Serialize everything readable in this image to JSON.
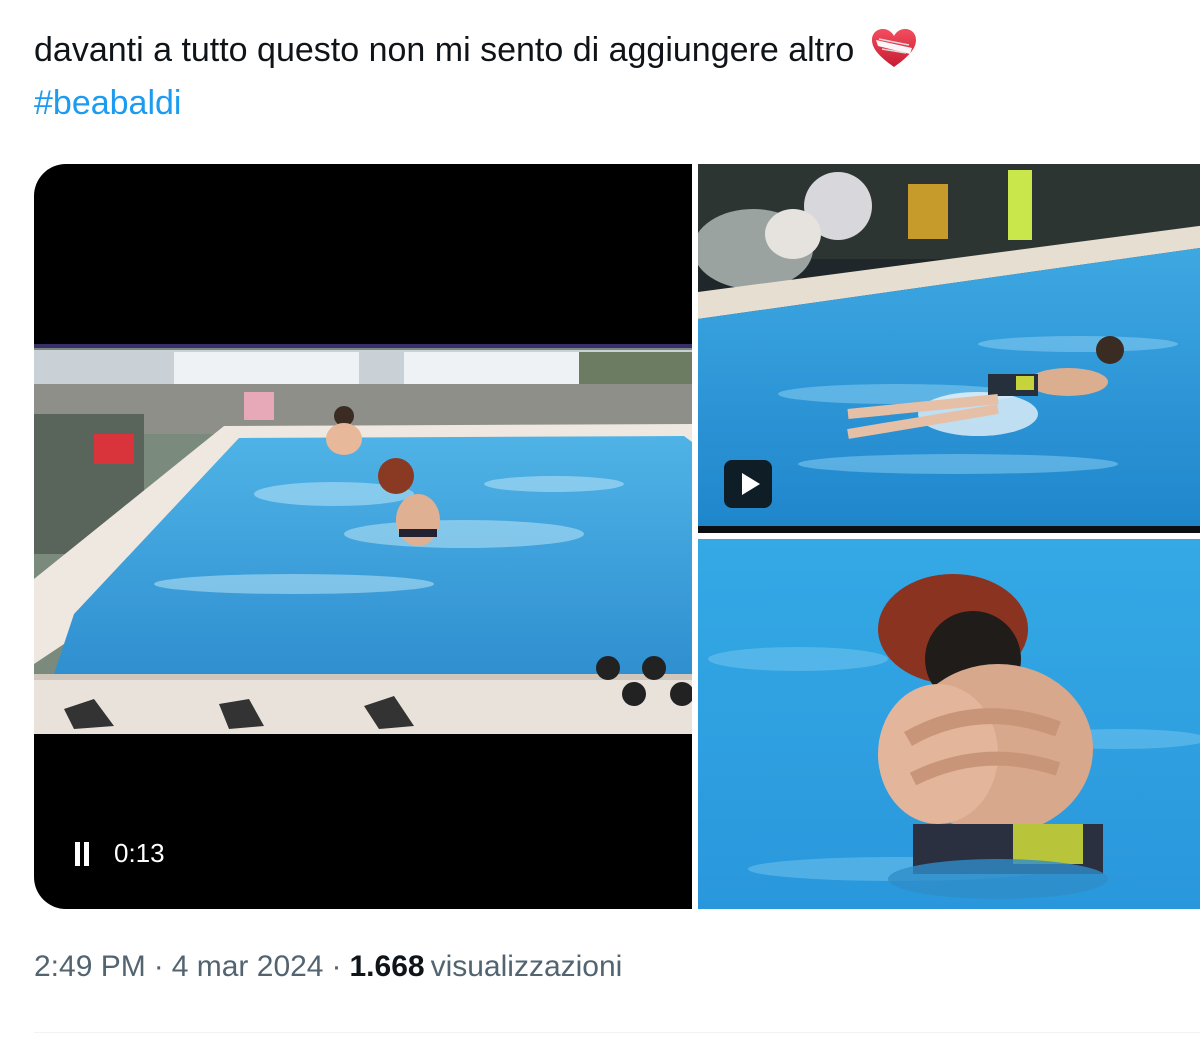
{
  "tweet": {
    "text": "davanti a tutto questo non mi sento di aggiungere altro",
    "hashtag": "#beabaldi",
    "emoji_icon": "mending-heart-icon"
  },
  "media": {
    "video": {
      "elapsed": "0:13",
      "control_icon": "pause-icon"
    },
    "secondary_badge_icon": "play-icon"
  },
  "meta": {
    "time": "2:49 PM",
    "separator": "·",
    "date": "4 mar 2024",
    "views_count": "1.668",
    "views_label": "visualizzazioni"
  },
  "colors": {
    "text": "#0f1419",
    "link": "#1d9bf0",
    "muted": "#536471",
    "divider": "#eff3f4"
  }
}
